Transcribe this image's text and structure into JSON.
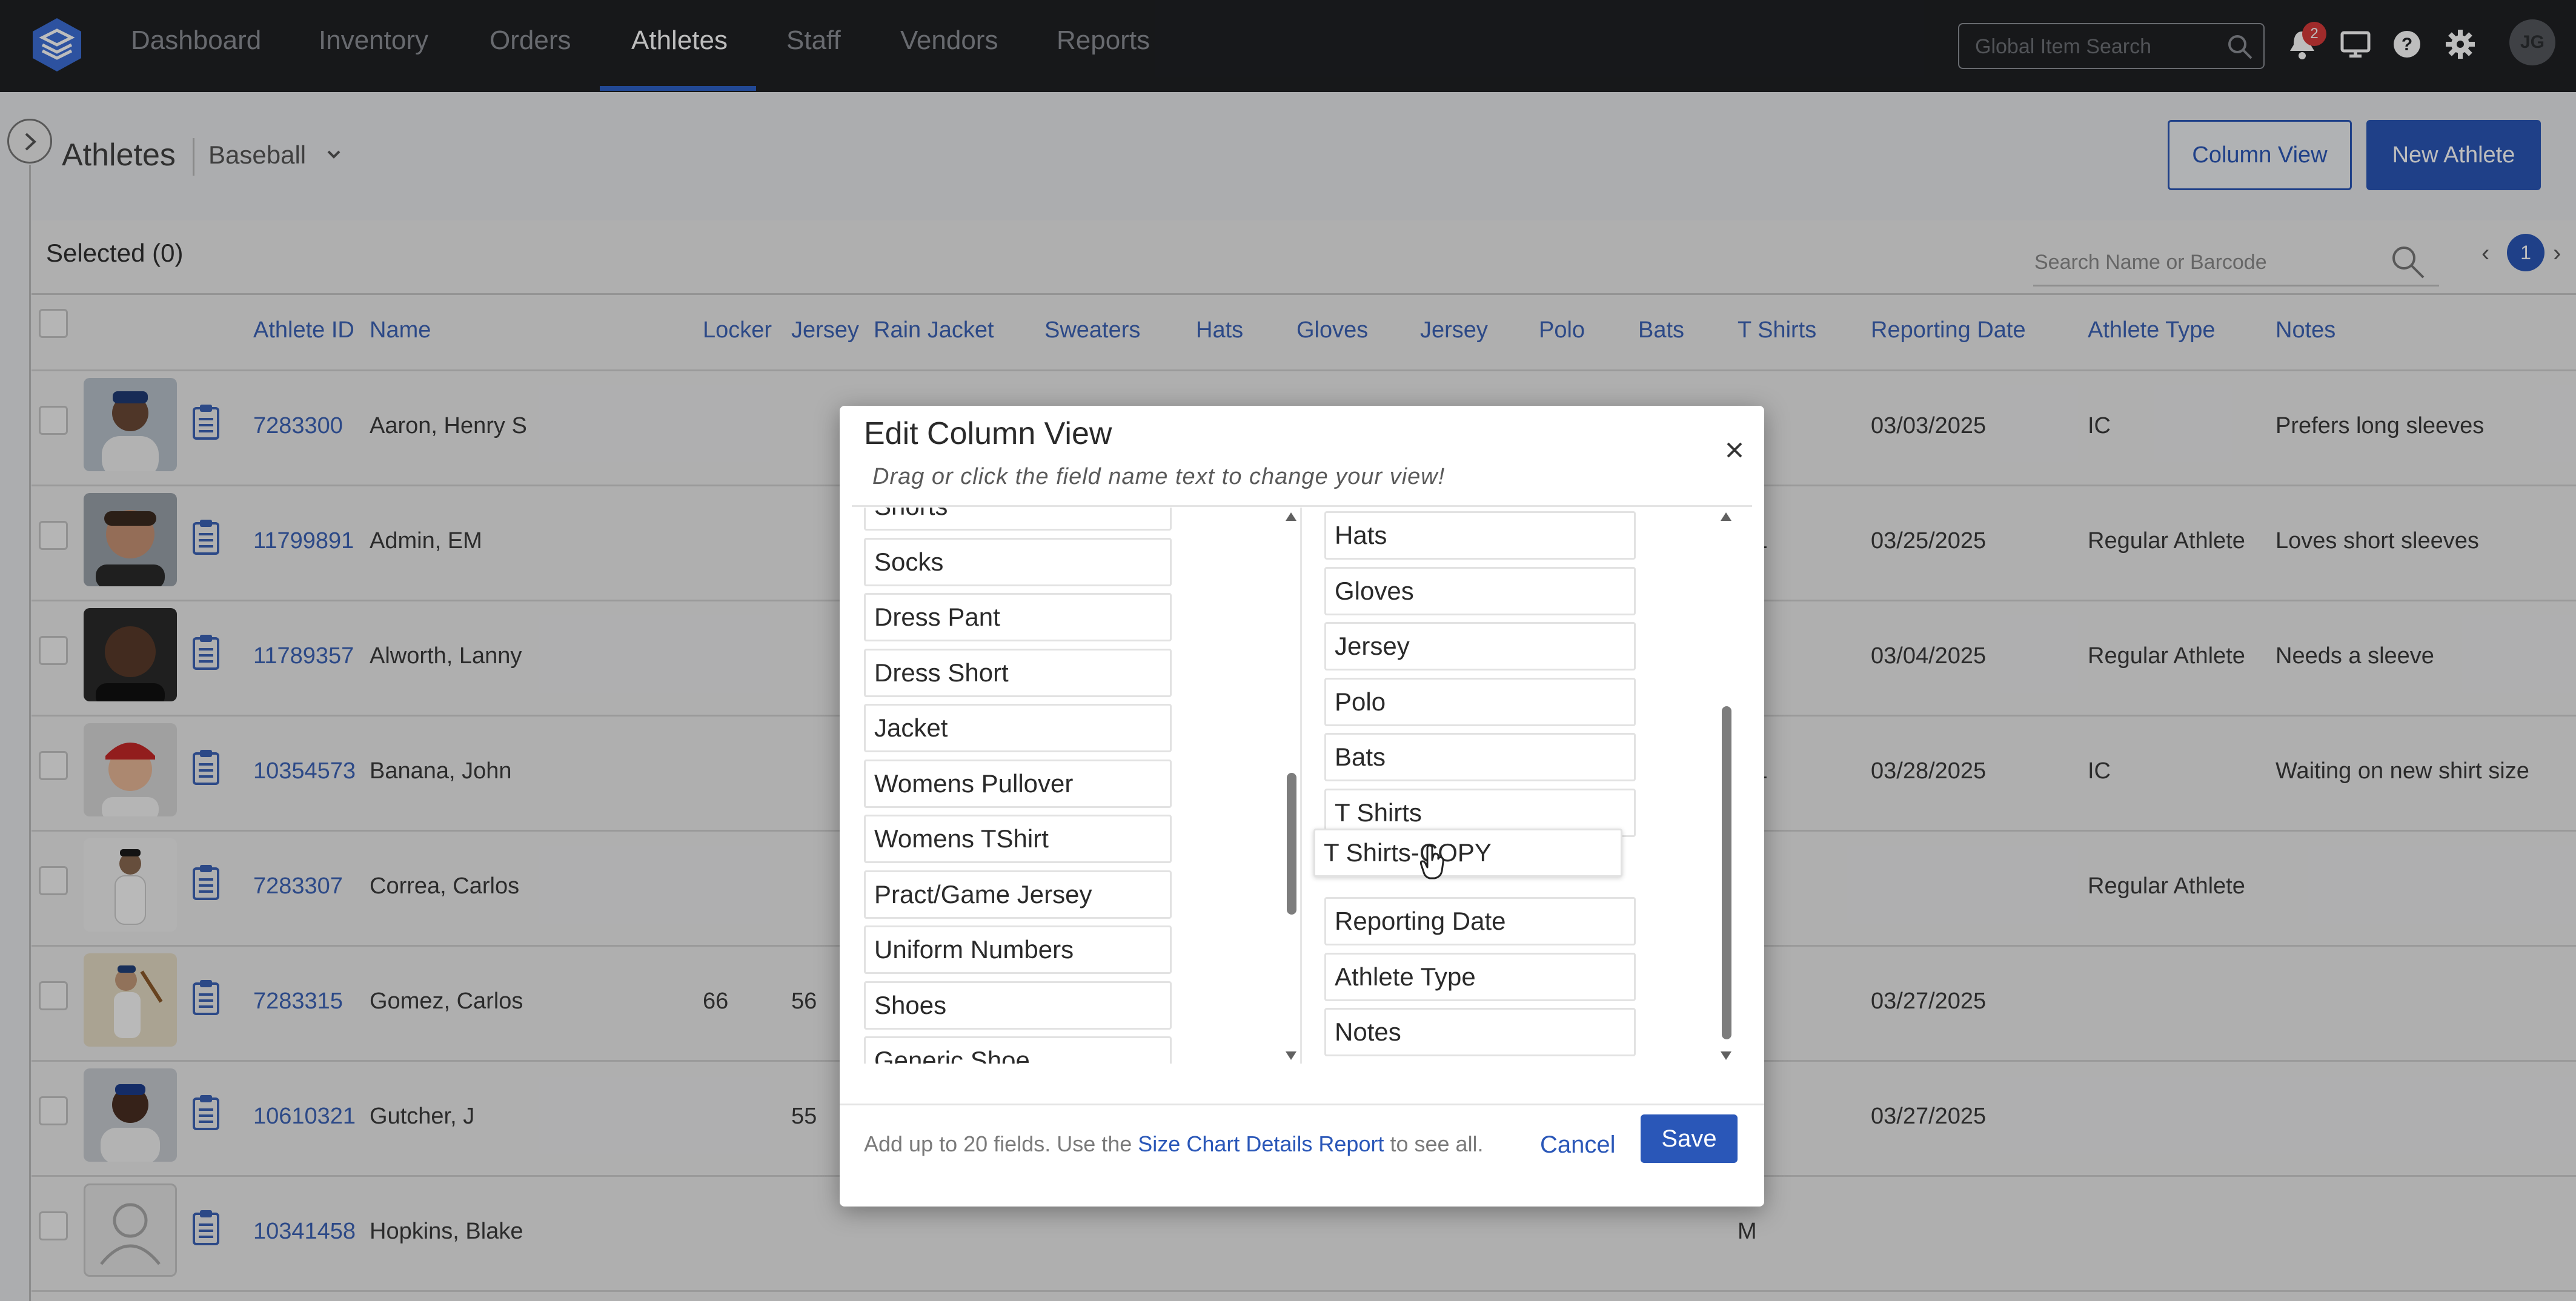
{
  "nav": {
    "items": [
      "Dashboard",
      "Inventory",
      "Orders",
      "Athletes",
      "Staff",
      "Vendors",
      "Reports"
    ],
    "active": "Athletes",
    "global_search_placeholder": "Global Item Search",
    "notification_count": "2",
    "user_initials": "JG",
    "icons": [
      "logo-icon",
      "search-icon",
      "bell-icon",
      "monitor-icon",
      "help-icon",
      "gear-icon",
      "user-avatar"
    ]
  },
  "header": {
    "title": "Athletes",
    "department": "Baseball",
    "column_view_button": "Column View",
    "new_athlete_button": "New Athlete"
  },
  "table": {
    "selected_label": "Selected (0)",
    "search_placeholder": "Search Name or Barcode",
    "page": "1",
    "prev": "‹",
    "next": "›",
    "columns": [
      "Athlete ID",
      "Name",
      "Locker",
      "Jersey",
      "Rain Jacket",
      "Sweaters",
      "Hats",
      "Gloves",
      "Jersey",
      "Polo",
      "Bats",
      "T Shirts",
      "Reporting Date",
      "Athlete Type",
      "Notes"
    ],
    "rows": [
      {
        "id": "7283300",
        "name": "Aaron, Henry S",
        "locker": "",
        "jersey": "",
        "tshirt": "",
        "date": "03/03/2025",
        "type": "IC",
        "notes": "Prefers long sleeves"
      },
      {
        "id": "11799891",
        "name": "Admin, EM",
        "locker": "",
        "jersey": "",
        "tshirt": "L",
        "date": "03/25/2025",
        "type": "Regular Athlete",
        "notes": "Loves short sleeves"
      },
      {
        "id": "11789357",
        "name": "Alworth, Lanny",
        "locker": "",
        "jersey": "",
        "tshirt": "",
        "date": "03/04/2025",
        "type": "Regular Athlete",
        "notes": "Needs a sleeve"
      },
      {
        "id": "10354573",
        "name": "Banana, John",
        "locker": "",
        "jersey": "",
        "tshirt": "L",
        "date": "03/28/2025",
        "type": "IC",
        "notes": "Waiting on new shirt size"
      },
      {
        "id": "7283307",
        "name": "Correa, Carlos",
        "locker": "",
        "jersey": "",
        "tshirt": "",
        "date": "",
        "type": "Regular Athlete",
        "notes": ""
      },
      {
        "id": "7283315",
        "name": "Gomez, Carlos",
        "locker": "66",
        "jersey": "56",
        "tshirt": "",
        "date": "03/27/2025",
        "type": "",
        "notes": ""
      },
      {
        "id": "10610321",
        "name": "Gutcher, J",
        "locker": "",
        "jersey": "55",
        "tshirt": "",
        "date": "03/27/2025",
        "type": "",
        "notes": ""
      },
      {
        "id": "10341458",
        "name": "Hopkins, Blake",
        "locker": "",
        "jersey": "",
        "tshirt": "M",
        "date": "",
        "type": "",
        "notes": ""
      }
    ]
  },
  "modal": {
    "title": "Edit Column View",
    "subtitle": "Drag or click the field name text to change your view!",
    "left_fields": [
      "Shorts",
      "Socks",
      "Dress Pant",
      "Dress Short",
      "Jacket",
      "Womens Pullover",
      "Womens TShirt",
      "Pract/Game Jersey",
      "Uniform Numbers",
      "Shoes",
      "Generic Shoe"
    ],
    "right_fields": [
      "Hats",
      "Gloves",
      "Jersey",
      "Polo",
      "Bats",
      "T Shirts",
      "Reporting Date",
      "Athlete Type",
      "Notes"
    ],
    "dragging_field": "T Shirts-COPY",
    "footer_prefix": "Add up to 20 fields. Use the ",
    "footer_link": "Size Chart Details Report",
    "footer_suffix": " to see all.",
    "cancel": "Cancel",
    "save": "Save"
  },
  "colors": {
    "accent": "#2a57b8",
    "nav_bg": "#1f2124",
    "link": "#3c63b6"
  }
}
